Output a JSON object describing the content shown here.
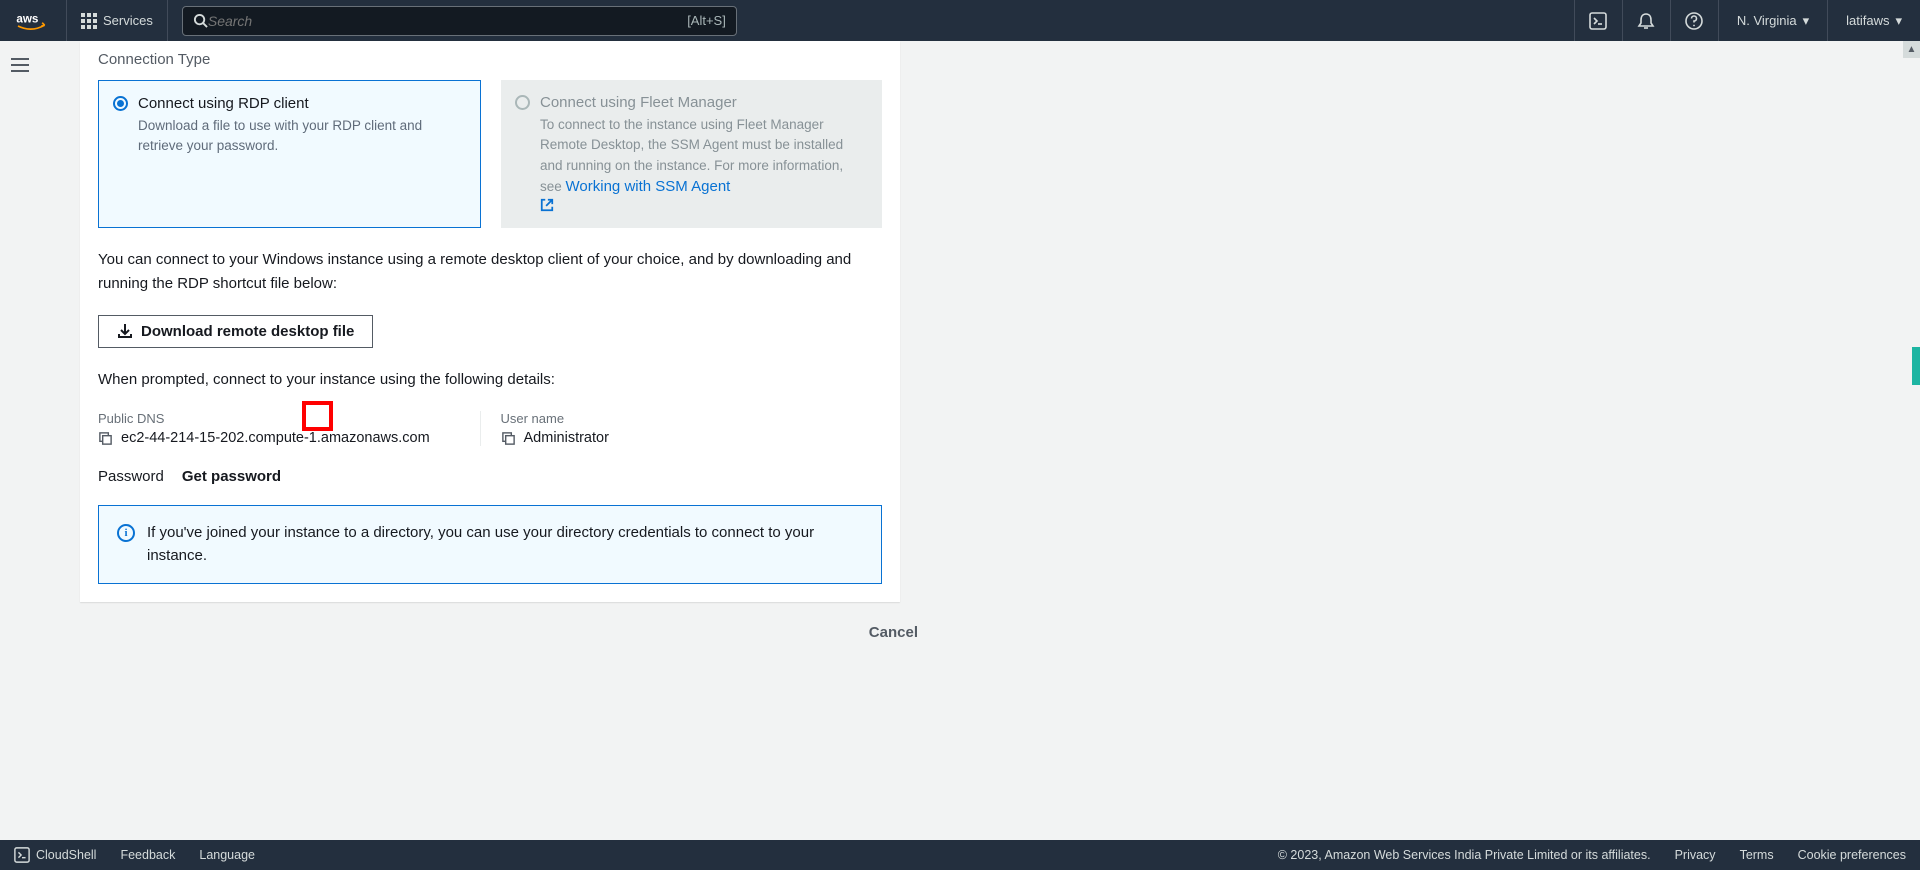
{
  "nav": {
    "services": "Services",
    "search_placeholder": "Search",
    "search_kbd": "[Alt+S]",
    "region": "N. Virginia",
    "account": "latifaws"
  },
  "main": {
    "section_title": "Connection Type",
    "opt1_title": "Connect using RDP client",
    "opt1_desc": "Download a file to use with your RDP client and retrieve your password.",
    "opt2_title": "Connect using Fleet Manager",
    "opt2_desc_a": "To connect to the instance using Fleet Manager Remote Desktop, the SSM Agent must be installed and running on the instance. For more information, see ",
    "opt2_link": "Working with SSM Agent",
    "instr": "You can connect to your Windows instance using a remote desktop client of your choice, and by downloading and running the RDP shortcut file below:",
    "download_btn": "Download remote desktop file",
    "prompt_text": "When prompted, connect to your instance using the following details:",
    "dns_label": "Public DNS",
    "dns_value": "ec2-44-214-15-202.compute-1.amazonaws.com",
    "user_label": "User name",
    "user_value": "Administrator",
    "pw_label": "Password",
    "pw_action": "Get password",
    "info_text": "If you've joined your instance to a directory, you can use your directory credentials to connect to your instance.",
    "cancel": "Cancel"
  },
  "footer": {
    "cloudshell": "CloudShell",
    "feedback": "Feedback",
    "language": "Language",
    "copyright": "© 2023, Amazon Web Services India Private Limited or its affiliates.",
    "privacy": "Privacy",
    "terms": "Terms",
    "cookies": "Cookie preferences"
  }
}
